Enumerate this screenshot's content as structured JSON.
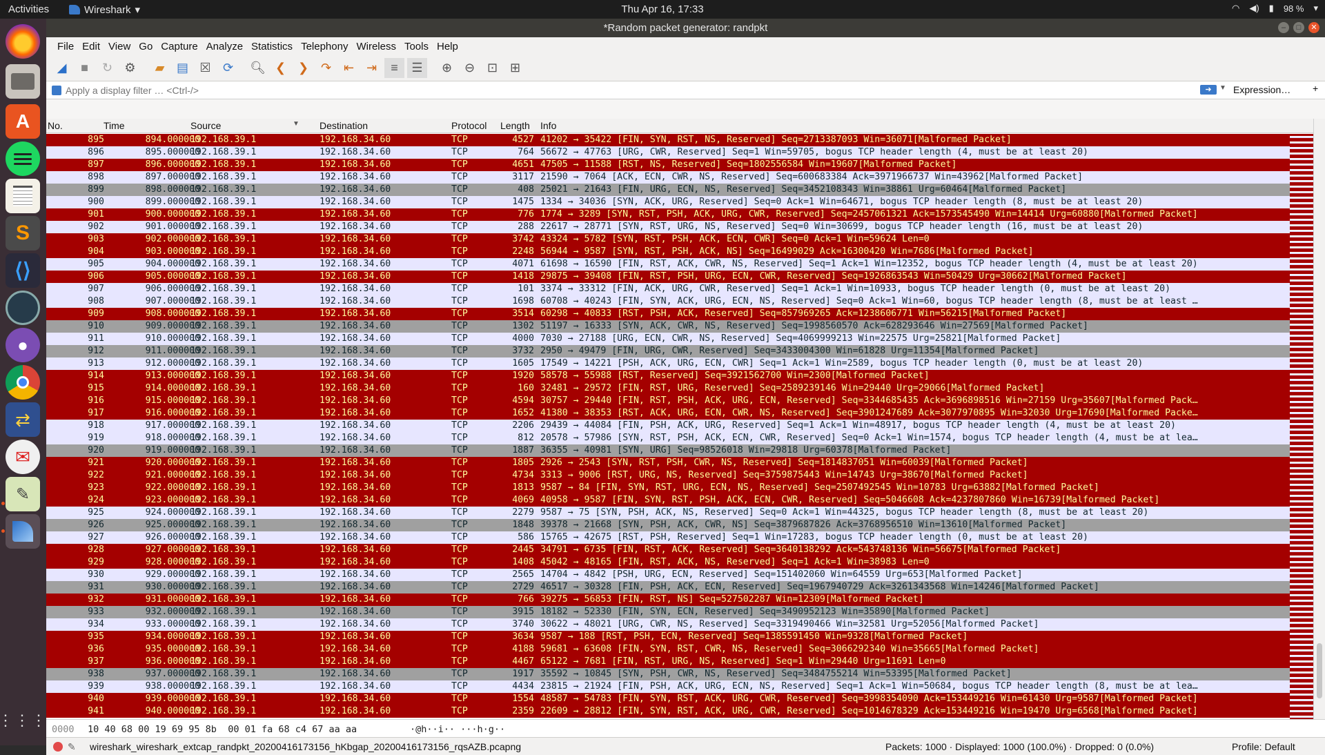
{
  "topbar": {
    "activities": "Activities",
    "app": "Wireshark",
    "clock": "Thu Apr 16, 17:33",
    "battery": "98 %"
  },
  "dock": {
    "items": [
      "firefox",
      "files",
      "software-center",
      "spotify",
      "text-editor",
      "sublime-text",
      "vscode",
      "system-monitor",
      "github",
      "chrome",
      "network-tool",
      "mail",
      "editor-tool",
      "wireshark"
    ]
  },
  "window": {
    "title": "*Random packet generator: randpkt"
  },
  "menu": [
    "File",
    "Edit",
    "View",
    "Go",
    "Capture",
    "Analyze",
    "Statistics",
    "Telephony",
    "Wireless",
    "Tools",
    "Help"
  ],
  "filter": {
    "placeholder": "Apply a display filter … <Ctrl-/>",
    "expression": "Expression…",
    "plus": "+"
  },
  "columns": {
    "no": "No.",
    "time": "Time",
    "source": "Source",
    "destination": "Destination",
    "protocol": "Protocol",
    "length": "Length",
    "info": "Info"
  },
  "packets": [
    {
      "no": "895",
      "time": "894.000000",
      "src": "192.168.39.1",
      "dst": "192.168.34.60",
      "proto": "TCP",
      "len": "4527",
      "info": "41202 → 35422 [FIN, SYN, RST, NS, Reserved] Seq=2713387093 Win=36071[Malformed Packet]",
      "style": "red"
    },
    {
      "no": "896",
      "time": "895.000000",
      "src": "192.168.39.1",
      "dst": "192.168.34.60",
      "proto": "TCP",
      "len": "764",
      "info": "56672 → 47763 [URG, CWR, Reserved] Seq=1 Win=59705, bogus TCP header length (4, must be at least 20)",
      "style": "white"
    },
    {
      "no": "897",
      "time": "896.000000",
      "src": "192.168.39.1",
      "dst": "192.168.34.60",
      "proto": "TCP",
      "len": "4651",
      "info": "47505 → 11588 [RST, NS, Reserved] Seq=1802556584 Win=19607[Malformed Packet]",
      "style": "red"
    },
    {
      "no": "898",
      "time": "897.000000",
      "src": "192.168.39.1",
      "dst": "192.168.34.60",
      "proto": "TCP",
      "len": "3117",
      "info": "21590 → 7064 [ACK, ECN, CWR, NS, Reserved] Seq=600683384 Ack=3971966737 Win=43962[Malformed Packet]",
      "style": "white"
    },
    {
      "no": "899",
      "time": "898.000000",
      "src": "192.168.39.1",
      "dst": "192.168.34.60",
      "proto": "TCP",
      "len": "408",
      "info": "25021 → 21643 [FIN, URG, ECN, NS, Reserved] Seq=3452108343 Win=38861 Urg=60464[Malformed Packet]",
      "style": "gray"
    },
    {
      "no": "900",
      "time": "899.000000",
      "src": "192.168.39.1",
      "dst": "192.168.34.60",
      "proto": "TCP",
      "len": "1475",
      "info": "1334 → 34036 [SYN, ACK, URG, Reserved] Seq=0 Ack=1 Win=64671, bogus TCP header length (8, must be at least 20)",
      "style": "white"
    },
    {
      "no": "901",
      "time": "900.000000",
      "src": "192.168.39.1",
      "dst": "192.168.34.60",
      "proto": "TCP",
      "len": "776",
      "info": "1774 → 3289 [SYN, RST, PSH, ACK, URG, CWR, Reserved] Seq=2457061321 Ack=1573545490 Win=14414 Urg=60880[Malformed Packet]",
      "style": "red"
    },
    {
      "no": "902",
      "time": "901.000000",
      "src": "192.168.39.1",
      "dst": "192.168.34.60",
      "proto": "TCP",
      "len": "288",
      "info": "22617 → 28771 [SYN, RST, URG, NS, Reserved] Seq=0 Win=30699, bogus TCP header length (16, must be at least 20)",
      "style": "white"
    },
    {
      "no": "903",
      "time": "902.000000",
      "src": "192.168.39.1",
      "dst": "192.168.34.60",
      "proto": "TCP",
      "len": "3742",
      "info": "43324 → 5782 [SYN, RST, PSH, ACK, ECN, CWR] Seq=0 Ack=1 Win=59624 Len=0",
      "style": "red"
    },
    {
      "no": "904",
      "time": "903.000000",
      "src": "192.168.39.1",
      "dst": "192.168.34.60",
      "proto": "TCP",
      "len": "2248",
      "info": "56944 → 9587 [SYN, RST, PSH, ACK, NS] Seq=16499029 Ack=16300420 Win=7686[Malformed Packet]",
      "style": "red"
    },
    {
      "no": "905",
      "time": "904.000000",
      "src": "192.168.39.1",
      "dst": "192.168.34.60",
      "proto": "TCP",
      "len": "4071",
      "info": "61698 → 16590 [FIN, RST, ACK, CWR, NS, Reserved] Seq=1 Ack=1 Win=12352, bogus TCP header length (4, must be at least 20)",
      "style": "white"
    },
    {
      "no": "906",
      "time": "905.000000",
      "src": "192.168.39.1",
      "dst": "192.168.34.60",
      "proto": "TCP",
      "len": "1418",
      "info": "29875 → 39408 [FIN, RST, PSH, URG, ECN, CWR, Reserved] Seq=1926863543 Win=50429 Urg=30662[Malformed Packet]",
      "style": "red"
    },
    {
      "no": "907",
      "time": "906.000000",
      "src": "192.168.39.1",
      "dst": "192.168.34.60",
      "proto": "TCP",
      "len": "101",
      "info": "3374 → 33312 [FIN, ACK, URG, CWR, Reserved] Seq=1 Ack=1 Win=10933, bogus TCP header length (0, must be at least 20)",
      "style": "white"
    },
    {
      "no": "908",
      "time": "907.000000",
      "src": "192.168.39.1",
      "dst": "192.168.34.60",
      "proto": "TCP",
      "len": "1698",
      "info": "60708 → 40243 [FIN, SYN, ACK, URG, ECN, NS, Reserved] Seq=0 Ack=1 Win=60, bogus TCP header length (8, must be at least …",
      "style": "white"
    },
    {
      "no": "909",
      "time": "908.000000",
      "src": "192.168.39.1",
      "dst": "192.168.34.60",
      "proto": "TCP",
      "len": "3514",
      "info": "60298 → 40833 [RST, PSH, ACK, Reserved] Seq=857969265 Ack=1238606771 Win=56215[Malformed Packet]",
      "style": "red"
    },
    {
      "no": "910",
      "time": "909.000000",
      "src": "192.168.39.1",
      "dst": "192.168.34.60",
      "proto": "TCP",
      "len": "1302",
      "info": "51197 → 16333 [SYN, ACK, CWR, NS, Reserved] Seq=1998560570 Ack=628293646 Win=27569[Malformed Packet]",
      "style": "gray"
    },
    {
      "no": "911",
      "time": "910.000000",
      "src": "192.168.39.1",
      "dst": "192.168.34.60",
      "proto": "TCP",
      "len": "4000",
      "info": "7030 → 27188 [URG, ECN, CWR, NS, Reserved] Seq=4069999213 Win=22575 Urg=25821[Malformed Packet]",
      "style": "white"
    },
    {
      "no": "912",
      "time": "911.000000",
      "src": "192.168.39.1",
      "dst": "192.168.34.60",
      "proto": "TCP",
      "len": "3732",
      "info": "2950 → 49479 [FIN, URG, CWR, Reserved] Seq=3433004300 Win=61828 Urg=11354[Malformed Packet]",
      "style": "gray"
    },
    {
      "no": "913",
      "time": "912.000000",
      "src": "192.168.39.1",
      "dst": "192.168.34.60",
      "proto": "TCP",
      "len": "1605",
      "info": "17549 → 14221 [PSH, ACK, URG, ECN, CWR] Seq=1 Ack=1 Win=2589, bogus TCP header length (0, must be at least 20)",
      "style": "white"
    },
    {
      "no": "914",
      "time": "913.000000",
      "src": "192.168.39.1",
      "dst": "192.168.34.60",
      "proto": "TCP",
      "len": "1920",
      "info": "58578 → 55988 [RST, Reserved] Seq=3921562700 Win=2300[Malformed Packet]",
      "style": "red"
    },
    {
      "no": "915",
      "time": "914.000000",
      "src": "192.168.39.1",
      "dst": "192.168.34.60",
      "proto": "TCP",
      "len": "160",
      "info": "32481 → 29572 [FIN, RST, URG, Reserved] Seq=2589239146 Win=29440 Urg=29066[Malformed Packet]",
      "style": "red"
    },
    {
      "no": "916",
      "time": "915.000000",
      "src": "192.168.39.1",
      "dst": "192.168.34.60",
      "proto": "TCP",
      "len": "4594",
      "info": "30757 → 29440 [FIN, RST, PSH, ACK, URG, ECN, Reserved] Seq=3344685435 Ack=3696898516 Win=27159 Urg=35607[Malformed Pack…",
      "style": "red"
    },
    {
      "no": "917",
      "time": "916.000000",
      "src": "192.168.39.1",
      "dst": "192.168.34.60",
      "proto": "TCP",
      "len": "1652",
      "info": "41380 → 38353 [RST, ACK, URG, ECN, CWR, NS, Reserved] Seq=3901247689 Ack=3077970895 Win=32030 Urg=17690[Malformed Packe…",
      "style": "red"
    },
    {
      "no": "918",
      "time": "917.000000",
      "src": "192.168.39.1",
      "dst": "192.168.34.60",
      "proto": "TCP",
      "len": "2206",
      "info": "29439 → 44084 [FIN, PSH, ACK, URG, Reserved] Seq=1 Ack=1 Win=48917, bogus TCP header length (4, must be at least 20)",
      "style": "white"
    },
    {
      "no": "919",
      "time": "918.000000",
      "src": "192.168.39.1",
      "dst": "192.168.34.60",
      "proto": "TCP",
      "len": "812",
      "info": "20578 → 57986 [SYN, RST, PSH, ACK, ECN, CWR, Reserved] Seq=0 Ack=1 Win=1574, bogus TCP header length (4, must be at lea…",
      "style": "white"
    },
    {
      "no": "920",
      "time": "919.000000",
      "src": "192.168.39.1",
      "dst": "192.168.34.60",
      "proto": "TCP",
      "len": "1887",
      "info": "36355 → 40981 [SYN, URG] Seq=98526018 Win=29818 Urg=60378[Malformed Packet]",
      "style": "gray"
    },
    {
      "no": "921",
      "time": "920.000000",
      "src": "192.168.39.1",
      "dst": "192.168.34.60",
      "proto": "TCP",
      "len": "1805",
      "info": "2926 → 2543 [SYN, RST, PSH, CWR, NS, Reserved] Seq=1814837051 Win=60039[Malformed Packet]",
      "style": "red"
    },
    {
      "no": "922",
      "time": "921.000000",
      "src": "192.168.39.1",
      "dst": "192.168.34.60",
      "proto": "TCP",
      "len": "4734",
      "info": "3313 → 9006 [RST, URG, NS, Reserved] Seq=3759875443 Win=14743 Urg=38670[Malformed Packet]",
      "style": "red"
    },
    {
      "no": "923",
      "time": "922.000000",
      "src": "192.168.39.1",
      "dst": "192.168.34.60",
      "proto": "TCP",
      "len": "1813",
      "info": "9587 → 84 [FIN, SYN, RST, URG, ECN, NS, Reserved] Seq=2507492545 Win=10783 Urg=63882[Malformed Packet]",
      "style": "red"
    },
    {
      "no": "924",
      "time": "923.000000",
      "src": "192.168.39.1",
      "dst": "192.168.34.60",
      "proto": "TCP",
      "len": "4069",
      "info": "40958 → 9587 [FIN, SYN, RST, PSH, ACK, ECN, CWR, Reserved] Seq=5046608 Ack=4237807860 Win=16739[Malformed Packet]",
      "style": "red"
    },
    {
      "no": "925",
      "time": "924.000000",
      "src": "192.168.39.1",
      "dst": "192.168.34.60",
      "proto": "TCP",
      "len": "2279",
      "info": "9587 → 75 [SYN, PSH, ACK, NS, Reserved] Seq=0 Ack=1 Win=44325, bogus TCP header length (8, must be at least 20)",
      "style": "white"
    },
    {
      "no": "926",
      "time": "925.000000",
      "src": "192.168.39.1",
      "dst": "192.168.34.60",
      "proto": "TCP",
      "len": "1848",
      "info": "39378 → 21668 [SYN, PSH, ACK, CWR, NS] Seq=3879687826 Ack=3768956510 Win=13610[Malformed Packet]",
      "style": "gray"
    },
    {
      "no": "927",
      "time": "926.000000",
      "src": "192.168.39.1",
      "dst": "192.168.34.60",
      "proto": "TCP",
      "len": "586",
      "info": "15765 → 42675 [RST, PSH, Reserved] Seq=1 Win=17283, bogus TCP header length (0, must be at least 20)",
      "style": "white"
    },
    {
      "no": "928",
      "time": "927.000000",
      "src": "192.168.39.1",
      "dst": "192.168.34.60",
      "proto": "TCP",
      "len": "2445",
      "info": "34791 → 6735 [FIN, RST, ACK, Reserved] Seq=3640138292 Ack=543748136 Win=56675[Malformed Packet]",
      "style": "red"
    },
    {
      "no": "929",
      "time": "928.000000",
      "src": "192.168.39.1",
      "dst": "192.168.34.60",
      "proto": "TCP",
      "len": "1408",
      "info": "45042 → 48165 [FIN, RST, ACK, NS, Reserved] Seq=1 Ack=1 Win=38983 Len=0",
      "style": "red"
    },
    {
      "no": "930",
      "time": "929.000000",
      "src": "192.168.39.1",
      "dst": "192.168.34.60",
      "proto": "TCP",
      "len": "2565",
      "info": "14704 → 4842 [PSH, URG, ECN, Reserved] Seq=151402060 Win=64559 Urg=653[Malformed Packet]",
      "style": "white"
    },
    {
      "no": "931",
      "time": "930.000000",
      "src": "192.168.39.1",
      "dst": "192.168.34.60",
      "proto": "TCP",
      "len": "2729",
      "info": "46517 → 30328 [FIN, PSH, ACK, ECN, Reserved] Seq=1967940729 Ack=3261343568 Win=14246[Malformed Packet]",
      "style": "gray"
    },
    {
      "no": "932",
      "time": "931.000000",
      "src": "192.168.39.1",
      "dst": "192.168.34.60",
      "proto": "TCP",
      "len": "766",
      "info": "39275 → 56853 [FIN, RST, NS] Seq=527502287 Win=12309[Malformed Packet]",
      "style": "red"
    },
    {
      "no": "933",
      "time": "932.000000",
      "src": "192.168.39.1",
      "dst": "192.168.34.60",
      "proto": "TCP",
      "len": "3915",
      "info": "18182 → 52330 [FIN, SYN, ECN, Reserved] Seq=3490952123 Win=35890[Malformed Packet]",
      "style": "gray"
    },
    {
      "no": "934",
      "time": "933.000000",
      "src": "192.168.39.1",
      "dst": "192.168.34.60",
      "proto": "TCP",
      "len": "3740",
      "info": "30622 → 48021 [URG, CWR, NS, Reserved] Seq=3319490466 Win=32581 Urg=52056[Malformed Packet]",
      "style": "white"
    },
    {
      "no": "935",
      "time": "934.000000",
      "src": "192.168.39.1",
      "dst": "192.168.34.60",
      "proto": "TCP",
      "len": "3634",
      "info": "9587 → 188 [RST, PSH, ECN, Reserved] Seq=1385591450 Win=9328[Malformed Packet]",
      "style": "red"
    },
    {
      "no": "936",
      "time": "935.000000",
      "src": "192.168.39.1",
      "dst": "192.168.34.60",
      "proto": "TCP",
      "len": "4188",
      "info": "59681 → 63608 [FIN, SYN, RST, CWR, NS, Reserved] Seq=3066292340 Win=35665[Malformed Packet]",
      "style": "red"
    },
    {
      "no": "937",
      "time": "936.000000",
      "src": "192.168.39.1",
      "dst": "192.168.34.60",
      "proto": "TCP",
      "len": "4467",
      "info": "65122 → 7681 [FIN, RST, URG, NS, Reserved] Seq=1 Win=29440 Urg=11691 Len=0",
      "style": "red"
    },
    {
      "no": "938",
      "time": "937.000000",
      "src": "192.168.39.1",
      "dst": "192.168.34.60",
      "proto": "TCP",
      "len": "1917",
      "info": "35592 → 10845 [SYN, PSH, CWR, NS, Reserved] Seq=3484755214 Win=53395[Malformed Packet]",
      "style": "gray"
    },
    {
      "no": "939",
      "time": "938.000000",
      "src": "192.168.39.1",
      "dst": "192.168.34.60",
      "proto": "TCP",
      "len": "4434",
      "info": "23815 → 21924 [FIN, PSH, ACK, URG, ECN, NS, Reserved] Seq=1 Ack=1 Win=50684, bogus TCP header length (8, must be at lea…",
      "style": "white"
    },
    {
      "no": "940",
      "time": "939.000000",
      "src": "192.168.39.1",
      "dst": "192.168.34.60",
      "proto": "TCP",
      "len": "1554",
      "info": "48587 → 54783 [FIN, SYN, RST, ACK, URG, CWR, Reserved] Seq=3998354090 Ack=153449216 Win=61430 Urg=9587[Malformed Packet]",
      "style": "red"
    },
    {
      "no": "941",
      "time": "940.000000",
      "src": "192.168.39.1",
      "dst": "192.168.34.60",
      "proto": "TCP",
      "len": "2359",
      "info": "22609 → 28812 [FIN, SYN, RST, ACK, URG, CWR, Reserved] Seq=1014678329 Ack=153449216 Win=19470 Urg=6568[Malformed Packet]",
      "style": "red"
    }
  ],
  "bytes": {
    "offset": "0000",
    "hex": "10 40 68 00 19 69 95 8b  00 01 fa 68 c4 67 aa aa",
    "ascii": "·@h··i·· ···h·g··"
  },
  "status": {
    "file": "wireshark_wireshark_extcap_randpkt_20200416173156_hKbgap_20200416173156_rqsAZB.pcapng",
    "packets": "Packets: 1000 · Displayed: 1000 (100.0%) · Dropped: 0 (0.0%)",
    "profile": "Profile: Default"
  },
  "colors": {
    "malformed_bg": "#a40000",
    "malformed_fg": "#fffc9c",
    "tcp_bg": "#e7e6ff",
    "gray_bg": "#a0a0a0"
  }
}
